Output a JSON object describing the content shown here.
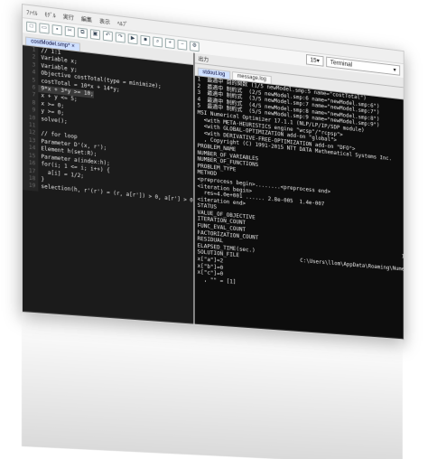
{
  "menubar": [
    "ﾌｧｲﾙ",
    "ﾓﾃﾞﾙ",
    "実行",
    "編集",
    "表示",
    "ﾍﾙﾌﾟ"
  ],
  "toolbar": {
    "zoom_value": "15",
    "output_target": "Terminal"
  },
  "left_pane": {
    "tab_label": "costModel.smp* ×",
    "lines": [
      "// 1:1",
      "Variable x;",
      "Variable y;",
      "Objective costTotal(type = minimize);",
      "costTotal = 10*x + 14*y;",
      "9*x + 3*y >= 10;",
      "x + y <= 5;",
      "x >= 0;",
      "y >= 0;",
      "solve();",
      "",
      "// for loop",
      "Parameter D'(x, r');",
      "Element h(set:R);",
      "Parameter a(index:h);",
      "for(i; 1 <= i; i++) {",
      "  a[i] = 1/2;",
      "}",
      "selection(h, r'(r') = (r, a[r']) > 0, a[r'] > 0"
    ],
    "highlight_index": 5
  },
  "right_pane": {
    "header_label": "出力",
    "tabs": [
      "stdout.log",
      "message.log"
    ],
    "lines": [
      "1  最適中 目的関数 (1/5 newModel.smp:5 name=\"costTotal\")",
      "2  最適中 制約式  (2/5 newModel.smp:6 name=\"newModel.smp:6\")",
      "3  最適中 制約式  (3/5 newModel.smp:7 name=\"newModel.smp:7\")",
      "4  最適中 制約式  (4/5 newModel.smp:8 name=\"newModel.smp:8\")",
      "5  最適中 制約式  (5/5 newModel.smp:9 name=\"newModel.smp:9\")",
      "MSI Numerical Optimizer 17.1.1 (NLP/LP/IP/SDP module)",
      "  <with META-HEURISTICS engine \"wcsp\"/\"rcpsp\">",
      "  <with GLOBAL-OPTIMIZATION add-on \"global\">",
      "  <with DERIVATIVE-FREE-OPTIMIZATION add-on \"DFO\">",
      "  , Copyright (C) 1991-2015 NTT DATA Mathematical Systems Inc.",
      "PROBLEM_NAME",
      "NUMBER_OF_VARIABLES",
      "NUMBER_OF_FUNCTIONS",
      "PROBLEM_TYPE",
      "METHOD",
      "<preprocess begin>........<preprocess end>",
      "<iteration begin>",
      "  res=4.0e+001 ...... 2.8e-005  1.4e-007",
      "<iteration end>",
      "STATUS",
      "VALUE_OF_OBJECTIVE",
      "ITERATION_COUNT",
      "FUNC_EVAL_COUNT",
      "FACTORIZATION_COUNT",
      "RESIDUAL",
      "ELAPSED_TIME(sec.)",
      "SOLUTION_FILE",
      "x[\"a\"]=2",
      "x[\"b\"]=0",
      "x[\"c\"]=0",
      "  , \"\" = [1]"
    ],
    "values": [
      "",
      "",
      "",
      "",
      "",
      "",
      "",
      "",
      "",
      "",
      "newModel",
      "2",
      "3",
      "MINIMIZATION",
      "HIGHER_ORDER",
      "",
      "",
      "",
      "",
      "OPTIMAL",
      "750.0000021",
      "6",
      "9",
      "7",
      "1.402395924e-007",
      "",
      "C:\\Users\\llom\\AppData\\Roaming\\NumericalOptimizerG",
      "",
      "",
      "",
      ""
    ]
  }
}
